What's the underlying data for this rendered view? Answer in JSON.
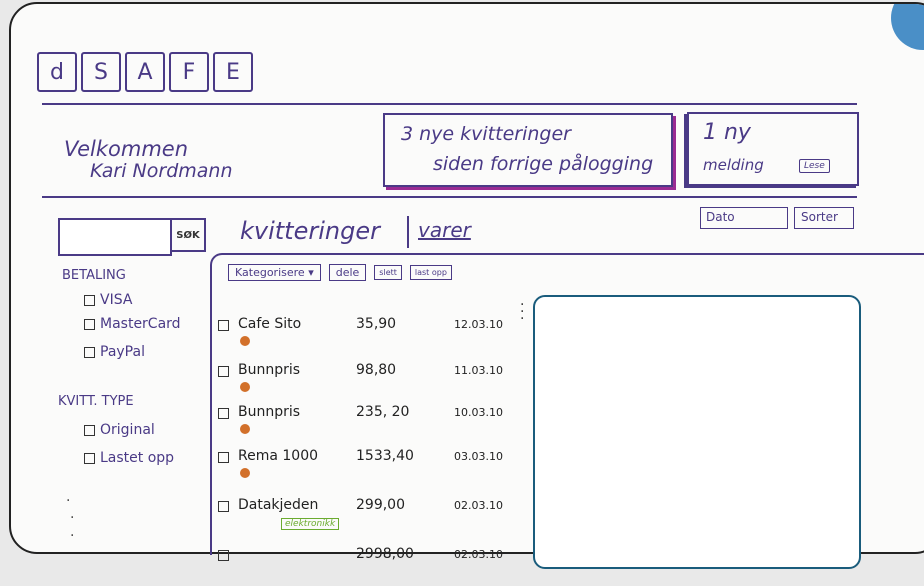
{
  "logo": [
    "d",
    "S",
    "A",
    "F",
    "E"
  ],
  "header": {
    "welcome_line1": "Velkommen",
    "welcome_line2": "Kari Nordmann",
    "notice_line1": "3 nye kvitteringer",
    "notice_line2": "siden forrige pålogging",
    "message_line1": "1 ny",
    "message_line2": "melding",
    "message_read": "Lese"
  },
  "search": {
    "value": "",
    "button_label": "SØK"
  },
  "tabs": {
    "receipts": "kvitteringer",
    "goods": "varer"
  },
  "controls": {
    "date": "Dato",
    "sort": "Sorter"
  },
  "sidebar": {
    "payment_heading": "BETALING",
    "payment_items": [
      "VISA",
      "MasterCard",
      "PayPal"
    ],
    "type_heading": "KVITT. TYPE",
    "type_items": [
      "Original",
      "Lastet opp"
    ]
  },
  "actions": {
    "categorize": "Kategorisere",
    "share": "dele",
    "delete": "slett",
    "upload": "last opp"
  },
  "receipts": [
    {
      "name": "Cafe Sito",
      "amount": "35,90",
      "date": "12.03.10"
    },
    {
      "name": "Bunnpris",
      "amount": "98,80",
      "date": "11.03.10"
    },
    {
      "name": "Bunnpris",
      "amount": "235, 20",
      "date": "10.03.10"
    },
    {
      "name": "Rema 1000",
      "amount": "1533,40",
      "date": "03.03.10"
    },
    {
      "name": "Datakjeden",
      "amount": "299,00",
      "date": "02.03.10",
      "tag": "elektronikk"
    },
    {
      "name": "",
      "amount": "2998,00",
      "date": "02.03.10"
    }
  ],
  "colors": {
    "ink": "#4a3a86",
    "accent_pink": "#9a2b93",
    "status_orange": "#d2702a",
    "tag_green": "#6bab2f",
    "preview_border": "#1a5c7c"
  }
}
